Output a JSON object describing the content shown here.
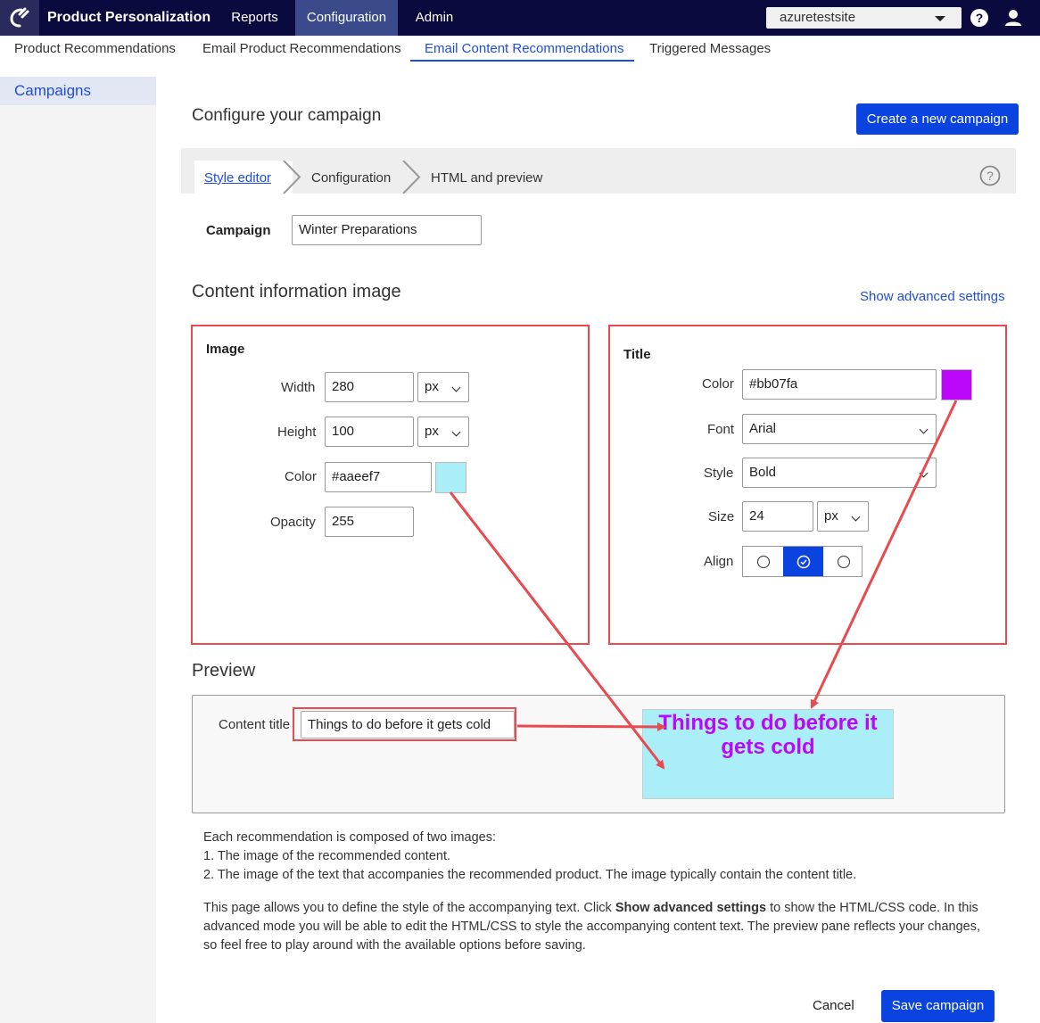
{
  "topnav": {
    "brand": "Product Personalization",
    "items": [
      {
        "label": "Reports"
      },
      {
        "label": "Configuration"
      },
      {
        "label": "Admin"
      }
    ],
    "site": "azuretestsite",
    "icons": [
      "help-icon",
      "user-icon"
    ]
  },
  "subnav": {
    "tabs": [
      {
        "label": "Product Recommendations"
      },
      {
        "label": "Email Product Recommendations"
      },
      {
        "label": "Email Content Recommendations"
      },
      {
        "label": "Triggered Messages"
      }
    ]
  },
  "sidebar": {
    "items": [
      {
        "label": "Campaigns"
      }
    ]
  },
  "main": {
    "title": "Configure your campaign",
    "create_button": "Create a new campaign",
    "steps": [
      {
        "label": "Style editor"
      },
      {
        "label": "Configuration"
      },
      {
        "label": "HTML and preview"
      }
    ],
    "campaign_label": "Campaign",
    "campaign_value": "Winter Preparations",
    "section_title": "Content information image",
    "advanced_link": "Show advanced settings",
    "image_panel": {
      "heading": "Image",
      "width_label": "Width",
      "width_value": "280",
      "width_unit": "px",
      "height_label": "Height",
      "height_value": "100",
      "height_unit": "px",
      "color_label": "Color",
      "color_value": "#aaeef7",
      "opacity_label": "Opacity",
      "opacity_value": "255"
    },
    "title_panel": {
      "heading": "Title",
      "color_label": "Color",
      "color_value": "#bb07fa",
      "font_label": "Font",
      "font_value": "Arial",
      "style_label": "Style",
      "style_value": "Bold",
      "size_label": "Size",
      "size_value": "24",
      "size_unit": "px",
      "align_label": "Align"
    },
    "preview": {
      "heading": "Preview",
      "content_title_label": "Content title",
      "content_title_value": "Things to do before it gets cold",
      "image_text": "Things to do before it gets cold"
    },
    "help": {
      "line1": "Each recommendation is composed of two images:",
      "line2": "1. The image of the recommended content.",
      "line3": "2. The image of the text that accompanies the recommended product. The image typically contain the content title.",
      "para2_before": "This page allows you to define the style of the accompanying text. Click ",
      "para2_bold": "Show advanced settings",
      "para2_after": " to show the HTML/CSS code. In this advanced mode you will be able to edit the HTML/CSS to style the accompanying content text. The preview pane reflects your changes, so feel free to play around with the available options before saving."
    },
    "cancel_label": "Cancel",
    "save_label": "Save campaign"
  },
  "colors": {
    "accent": "#0b43e0",
    "nav_bg": "#0b0a3e",
    "annotation": "#e84a50"
  }
}
